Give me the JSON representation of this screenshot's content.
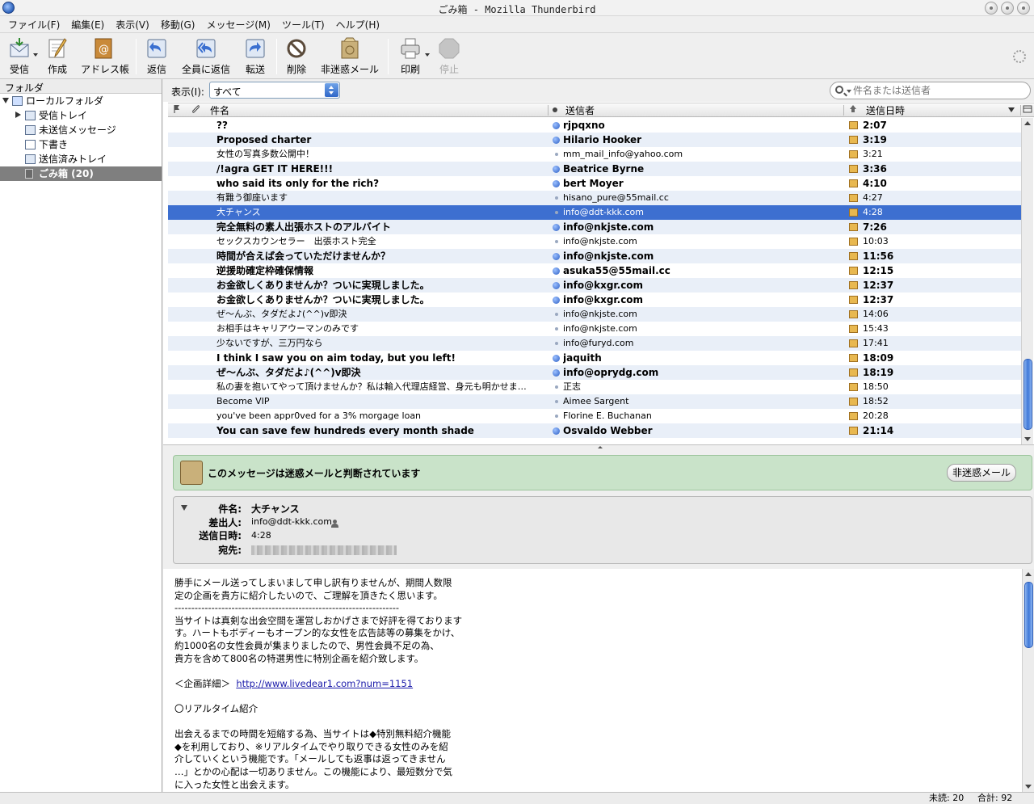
{
  "window": {
    "title": "ごみ箱 - Mozilla Thunderbird"
  },
  "menu": [
    "ファイル(F)",
    "編集(E)",
    "表示(V)",
    "移動(G)",
    "メッセージ(M)",
    "ツール(T)",
    "ヘルプ(H)"
  ],
  "toolbar": {
    "get_mail": "受信",
    "compose": "作成",
    "address_book": "アドレス帳",
    "reply": "返信",
    "reply_all": "全員に返信",
    "forward": "転送",
    "delete": "削除",
    "not_junk": "非迷惑メール",
    "print": "印刷",
    "stop": "停止"
  },
  "folders": {
    "header": "フォルダ",
    "items": [
      {
        "label": "ローカルフォルダ"
      },
      {
        "label": "受信トレイ"
      },
      {
        "label": "未送信メッセージ"
      },
      {
        "label": "下書き"
      },
      {
        "label": "送信済みトレイ"
      },
      {
        "label": "ごみ箱 (20)"
      }
    ]
  },
  "quickbar": {
    "view_label": "表示(I):",
    "view_value": "すべて",
    "search_placeholder": "件名または送信者"
  },
  "columns": {
    "subject": "件名",
    "sender": "送信者",
    "date": "送信日時"
  },
  "messages": [
    {
      "subject": "??",
      "sender": "rjpqxno",
      "date": "2:07",
      "unread": true
    },
    {
      "subject": "Proposed charter",
      "sender": "Hilario Hooker",
      "date": "3:19",
      "unread": true
    },
    {
      "subject": "女性の写真多数公開中！",
      "sender": "mm_mail_info@yahoo.com",
      "date": "3:21",
      "unread": false
    },
    {
      "subject": "/!agra GET IT HERE!!!",
      "sender": "Beatrice Byrne",
      "date": "3:36",
      "unread": true
    },
    {
      "subject": "who said its only for the rich?",
      "sender": "bert Moyer",
      "date": "4:10",
      "unread": true
    },
    {
      "subject": "有難う御座います",
      "sender": "hisano_pure@55mail.cc",
      "date": "4:27",
      "unread": false
    },
    {
      "subject": "大チャンス",
      "sender": "info@ddt-kkk.com",
      "date": "4:28",
      "unread": false,
      "selected": true
    },
    {
      "subject": "完全無料の素人出張ホストのアルバイト",
      "sender": "info@nkjste.com",
      "date": "7:26",
      "unread": true
    },
    {
      "subject": "セックスカウンセラー　出張ホスト完全",
      "sender": "info@nkjste.com",
      "date": "10:03",
      "unread": false
    },
    {
      "subject": "時間が合えば会っていただけませんか？",
      "sender": "info@nkjste.com",
      "date": "11:56",
      "unread": true
    },
    {
      "subject": "逆援助確定枠確保情報",
      "sender": "asuka55@55mail.cc",
      "date": "12:15",
      "unread": true
    },
    {
      "subject": "お金欲しくありませんか？ついに実現しました。",
      "sender": "info@kxgr.com",
      "date": "12:37",
      "unread": true
    },
    {
      "subject": "お金欲しくありませんか？ついに実現しました。",
      "sender": "info@kxgr.com",
      "date": "12:37",
      "unread": true
    },
    {
      "subject": "ぜ～んぶ、タダだよ♪(^^)v即決",
      "sender": "info@nkjste.com",
      "date": "14:06",
      "unread": false
    },
    {
      "subject": "お相手はキャリアウーマンのみです",
      "sender": "info@nkjste.com",
      "date": "15:43",
      "unread": false
    },
    {
      "subject": "少ないですが、三万円なら",
      "sender": "info@furyd.com",
      "date": "17:41",
      "unread": false
    },
    {
      "subject": "I think I saw you on aim today, but you left!",
      "sender": "jaquith",
      "date": "18:09",
      "unread": true
    },
    {
      "subject": "ぜ～んぶ、タダだよ♪(^^)v即決",
      "sender": "info@oprydg.com",
      "date": "18:19",
      "unread": true
    },
    {
      "subject": "私の妻を抱いてやって頂けませんか？私は輸入代理店経営、身元も明かせま…",
      "sender": "正志",
      "date": "18:50",
      "unread": false
    },
    {
      "subject": "Become VIP",
      "sender": "Aimee Sargent",
      "date": "18:52",
      "unread": false
    },
    {
      "subject": "you've been appr0ved for a 3% morgage loan",
      "sender": "Florine E. Buchanan",
      "date": "20:28",
      "unread": false
    },
    {
      "subject": "You can save few hundreds every month shade",
      "sender": "Osvaldo Webber",
      "date": "21:14",
      "unread": true
    }
  ],
  "junk_bar": {
    "message": "このメッセージは迷惑メールと判断されています",
    "button": "非迷惑メール"
  },
  "header_view": {
    "subject_label": "件名:",
    "subject": "大チャンス",
    "from_label": "差出人:",
    "from": "info@ddt-kkk.com",
    "date_label": "送信日時:",
    "date": "4:28",
    "to_label": "宛先:"
  },
  "body": {
    "before_link": "勝手にメール送ってしまいまして申し訳有りませんが、期間人数限\n定の企画を貴方に紹介したいので、ご理解を頂きたく思います。\n-------------------------------------------------------------------\n当サイトは真剣な出会空間を運営しおかげさまで好評を得ております\nす。ハートもボディーもオープン的な女性を広告誌等の募集をかけ、\n約1000名の女性会員が集まりましたので、男性会員不足の為、\n貴方を含めて800名の特選男性に特別企画を紹介致します。\n\n＜企画詳細＞  ",
    "link": "http://www.livedear1.com?num=1151",
    "after_link": "\n\n〇リアルタイム紹介\n\n出会えるまでの時間を短縮する為、当サイトは◆特別無料紹介機能\n◆を利用しており、※リアルタイムでやり取りできる女性のみを紹\n介していくという機能です。「メールしても返事は返ってきません\n…」とかの心配は一切ありません。この機能により、最短数分で気\nに入った女性と出会えます。"
  },
  "status": {
    "unread": "未読: 20",
    "total": "合計: 92"
  }
}
